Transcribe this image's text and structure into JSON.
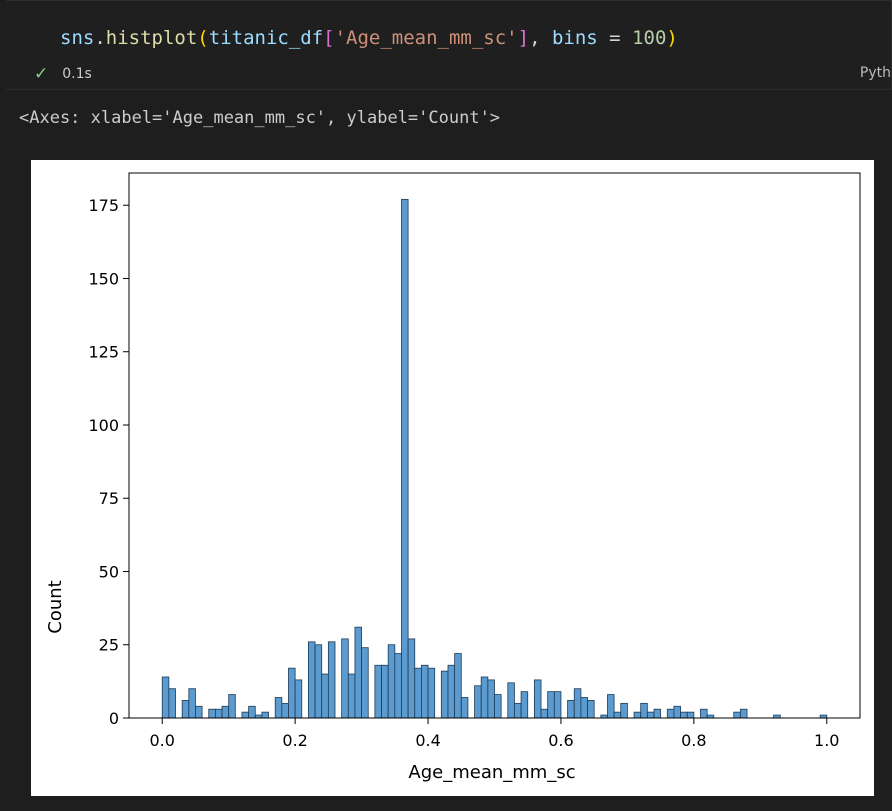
{
  "cell": {
    "code": {
      "var1": "sns",
      "dot": ".",
      "fn": "histplot",
      "open_paren": "(",
      "var2": "titanic_df",
      "open_brk": "[",
      "str": "'Age_mean_mm_sc'",
      "close_brk": "]",
      "comma": ", ",
      "kw": "bins",
      "eq": " = ",
      "num": "100",
      "close_paren": ")"
    },
    "status_icon": "check-icon",
    "exec_time": "0.1s",
    "language": "Pyth"
  },
  "output": {
    "repr": "<Axes: xlabel='Age_mean_mm_sc', ylabel='Count'>"
  },
  "colors": {
    "bar_fill": "#5b9bd0",
    "bar_edge": "#1f3b55",
    "check": "#89d185"
  },
  "chart_data": {
    "type": "bar",
    "title": "",
    "xlabel": "Age_mean_mm_sc",
    "ylabel": "Count",
    "xlim": [
      -0.05,
      1.05
    ],
    "ylim": [
      0,
      186
    ],
    "xticks": [
      "0.0",
      "0.2",
      "0.4",
      "0.6",
      "0.8",
      "1.0"
    ],
    "yticks": [
      "0",
      "25",
      "50",
      "75",
      "100",
      "125",
      "150",
      "175"
    ],
    "grid": false,
    "bin_range": [
      0.0,
      1.0
    ],
    "bins": 100,
    "values": [
      14,
      10,
      0,
      6,
      10,
      4,
      0,
      3,
      3,
      4,
      8,
      0,
      2,
      4,
      1,
      2,
      0,
      7,
      5,
      17,
      13,
      0,
      26,
      25,
      15,
      26,
      0,
      27,
      15,
      31,
      24,
      0,
      18,
      18,
      25,
      22,
      177,
      27,
      17,
      18,
      17,
      0,
      16,
      18,
      22,
      7,
      0,
      11,
      14,
      13,
      8,
      0,
      12,
      5,
      9,
      0,
      13,
      3,
      9,
      9,
      0,
      6,
      10,
      7,
      6,
      0,
      1,
      8,
      2,
      5,
      0,
      2,
      5,
      2,
      3,
      0,
      3,
      4,
      2,
      2,
      0,
      3,
      1,
      0,
      0,
      0,
      2,
      3,
      0,
      0,
      0,
      0,
      1,
      0,
      0,
      0,
      0,
      0,
      0,
      1
    ]
  }
}
